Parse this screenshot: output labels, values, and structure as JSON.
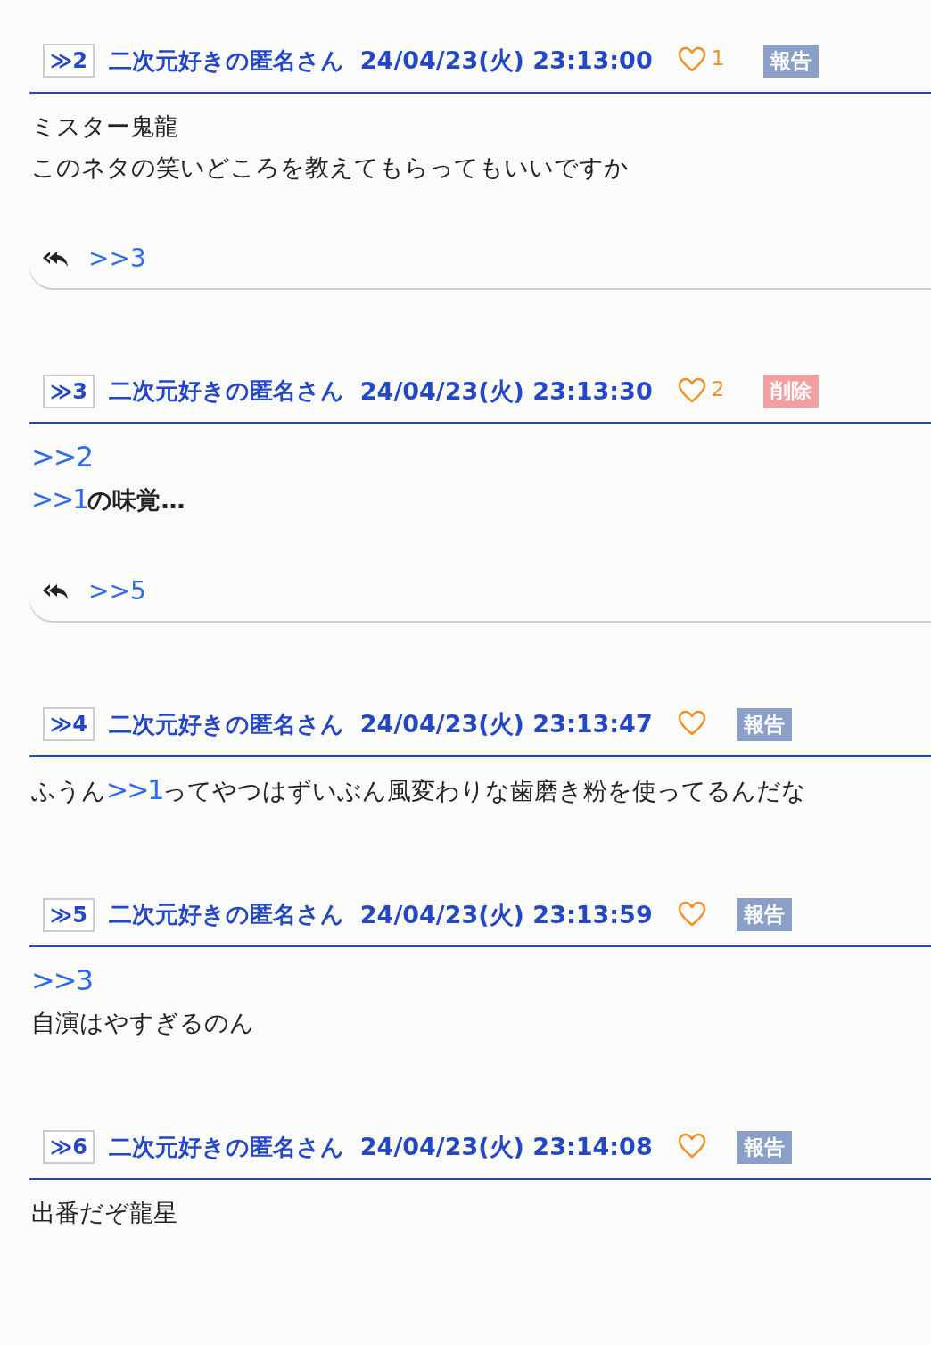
{
  "posts": [
    {
      "number": "≫2",
      "name": "二次元好きの匿名さん",
      "date": "24/04/23(火) 23:13:00",
      "likes": "1",
      "action": {
        "kind": "report",
        "label": "報告"
      },
      "bold": false,
      "lines": [
        [
          {
            "kind": "text",
            "text": "ミスター鬼龍"
          }
        ],
        [
          {
            "kind": "text",
            "text": "このネタの笑いどころを教えてもらってもいいですか"
          }
        ]
      ],
      "replies": [
        ">>3"
      ]
    },
    {
      "number": "≫3",
      "name": "二次元好きの匿名さん",
      "date": "24/04/23(火) 23:13:30",
      "likes": "2",
      "action": {
        "kind": "delete",
        "label": "削除"
      },
      "bold": true,
      "lines": [
        [
          {
            "kind": "anchor",
            "text": ">>2"
          }
        ],
        [
          {
            "kind": "anchor",
            "text": ">>1"
          },
          {
            "kind": "text",
            "text": "の味覚…"
          }
        ]
      ],
      "replies": [
        ">>5"
      ]
    },
    {
      "number": "≫4",
      "name": "二次元好きの匿名さん",
      "date": "24/04/23(火) 23:13:47",
      "action": {
        "kind": "report",
        "label": "報告"
      },
      "bold": false,
      "lines": [
        [
          {
            "kind": "text",
            "text": "ふうん"
          },
          {
            "kind": "anchor",
            "text": ">>1"
          },
          {
            "kind": "text",
            "text": "ってやつはずいぶん風変わりな歯磨き粉を使ってるんだな"
          }
        ]
      ]
    },
    {
      "number": "≫5",
      "name": "二次元好きの匿名さん",
      "date": "24/04/23(火) 23:13:59",
      "action": {
        "kind": "report",
        "label": "報告"
      },
      "bold": false,
      "lines": [
        [
          {
            "kind": "anchor",
            "text": ">>3"
          }
        ],
        [
          {
            "kind": "text",
            "text": "自演はやすぎるのん"
          }
        ]
      ]
    },
    {
      "number": "≫6",
      "name": "二次元好きの匿名さん",
      "date": "24/04/23(火) 23:14:08",
      "action": {
        "kind": "report",
        "label": "報告"
      },
      "bold": false,
      "lines": [
        [
          {
            "kind": "text",
            "text": "出番だぞ龍星"
          }
        ]
      ]
    }
  ]
}
